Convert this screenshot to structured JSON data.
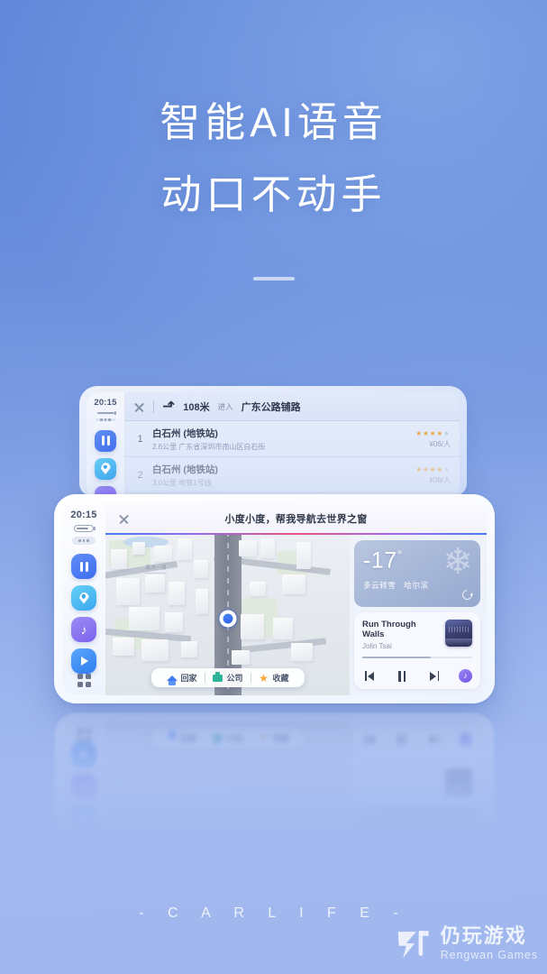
{
  "hero": {
    "line1": "智能AI语音",
    "line2": "动口不动手"
  },
  "footer": {
    "brand": "- C A R L I F E -"
  },
  "watermark": {
    "cn": "仍玩游戏",
    "en": "Rengwan Games",
    "logo_icon": "rengwan-logo-icon"
  },
  "back_tablet": {
    "status": {
      "time": "20:15",
      "battery_icon": "battery-icon",
      "menu_icon": "more-dots-icon"
    },
    "sidebar_apps": [
      {
        "name": "media-app-icon",
        "label": "II"
      },
      {
        "name": "map-app-icon",
        "label": ""
      },
      {
        "name": "music-app-icon",
        "label": "♪"
      }
    ],
    "navbar": {
      "close_icon": "close-icon",
      "turn_icon": "turn-right-icon",
      "distance": "108米",
      "into": "进入",
      "road": "广东公路铺路"
    },
    "results": [
      {
        "index": "1",
        "name": "白石州 (地铁站)",
        "sub": "2.6公里 广东省深圳市南山区白石街",
        "stars_on": 4,
        "stars_off": 1,
        "price": "¥06/人"
      },
      {
        "index": "2",
        "name": "白石州 (地铁站)",
        "sub": "3.0公里 地铁1号线",
        "stars_on": 4,
        "stars_off": 1,
        "price": "¥06/人"
      }
    ]
  },
  "front_tablet": {
    "status": {
      "time": "20:15",
      "battery_icon": "battery-icon",
      "menu_icon": "more-dots-icon"
    },
    "sidebar_apps": [
      {
        "name": "media-app-icon"
      },
      {
        "name": "map-app-icon"
      },
      {
        "name": "music-app-icon"
      },
      {
        "name": "video-app-icon"
      }
    ],
    "grid_icon": "app-grid-icon",
    "voice": {
      "close_icon": "close-icon",
      "command": "小度小度，帮我导航去世界之窗"
    },
    "map": {
      "street_label": "海河一路",
      "location_icon": "location-puck-icon"
    },
    "quick_actions": [
      {
        "icon": "home-icon",
        "label": "回家"
      },
      {
        "icon": "briefcase-icon",
        "label": "公司"
      },
      {
        "icon": "star-icon",
        "label": "收藏"
      }
    ],
    "weather": {
      "temperature": "-17",
      "degree": "°",
      "condition": "多云转雪",
      "city": "哈尔滨",
      "snow_icon": "snowflake-icon",
      "refresh_icon": "refresh-icon"
    },
    "music": {
      "title": "Run Through Walls",
      "artist": "Jolin Tsai",
      "progress_percent": 62,
      "prev_icon": "previous-track-icon",
      "pause_icon": "pause-icon",
      "next_icon": "next-track-icon",
      "app_icon": "music-app-badge-icon",
      "album_art_icon": "album-art"
    }
  },
  "colors": {
    "bg_top": "#5f86d8",
    "bg_bottom": "#9fb7ee",
    "accent_blue": "#3f6ef0",
    "star_orange": "#f2a93b",
    "music_purple": "#7256e8"
  }
}
